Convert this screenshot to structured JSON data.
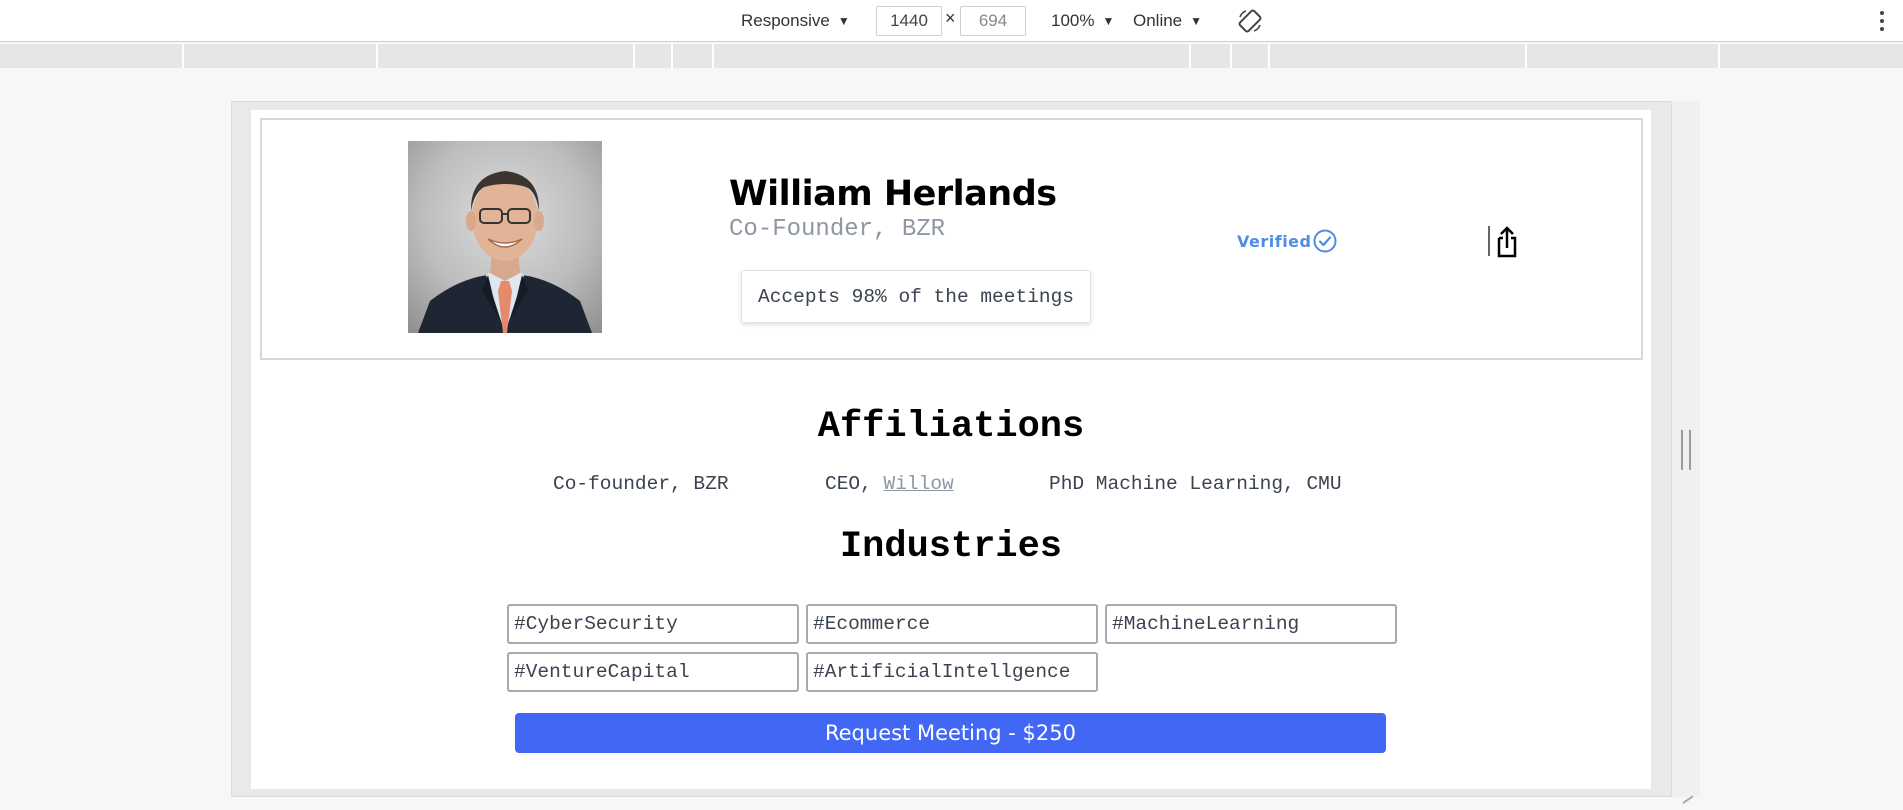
{
  "toolbar": {
    "device": "Responsive",
    "width": "1440",
    "times": "×",
    "height": "694",
    "zoom": "100%",
    "network": "Online",
    "icons": [
      "dropdown-caret-icon",
      "rotate-device-icon",
      "more-options-icon"
    ]
  },
  "profile": {
    "name": "William Herlands",
    "role": "Co-Founder, BZR",
    "accepts": "Accepts 98% of the meetings",
    "verified_label": "Verified",
    "verified_color": "#4f8de2"
  },
  "affiliations": {
    "title": "Affiliations",
    "item1": "Co-founder, BZR",
    "item2_prefix": "CEO,",
    "item2_link": "Willow",
    "item3": "PhD Machine Learning, CMU"
  },
  "industries": {
    "title": "Industries",
    "tags": [
      "#CyberSecurity",
      "#Ecommerce",
      "#MachineLearning",
      "#VentureCapital",
      "#ArtificialIntellgence"
    ]
  },
  "cta": {
    "label": "Request Meeting - $250",
    "color": "#4267f5"
  }
}
